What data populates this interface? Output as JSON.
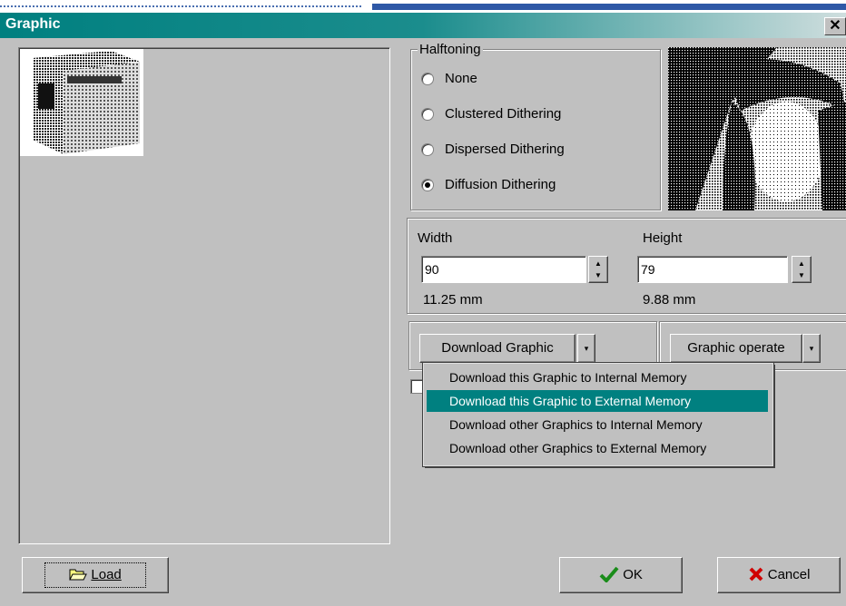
{
  "window": {
    "title": "Graphic",
    "close_glyph": "✕"
  },
  "halftoning": {
    "label": "Halftoning",
    "options": [
      {
        "label": "None",
        "selected": false
      },
      {
        "label": "Clustered Dithering",
        "selected": false
      },
      {
        "label": "Dispersed Dithering",
        "selected": false
      },
      {
        "label": "Diffusion Dithering",
        "selected": true
      }
    ]
  },
  "size": {
    "width_label": "Width",
    "width_value": "90",
    "width_mm": "11.25 mm",
    "height_label": "Height",
    "height_value": "79",
    "height_mm": "9.88 mm"
  },
  "download": {
    "button_label": "Download Graphic",
    "arrow_glyph": "▾",
    "menu_items": [
      {
        "label": "Download this Graphic to Internal Memory",
        "highlighted": false
      },
      {
        "label": "Download this Graphic to External Memory",
        "highlighted": true
      },
      {
        "label": "Download other Graphics to Internal Memory",
        "highlighted": false
      },
      {
        "label": "Download other Graphics to External Memory",
        "highlighted": false
      }
    ]
  },
  "operate": {
    "button_label": "Graphic operate",
    "arrow_glyph": "▾"
  },
  "buttons": {
    "load": {
      "label": "Load",
      "icon": "folder-open-icon"
    },
    "ok": {
      "label": "OK",
      "icon": "checkmark-icon"
    },
    "cancel": {
      "label": "Cancel",
      "icon": "red-x-icon"
    }
  },
  "colors": {
    "title_bar": "#008080",
    "menu_highlight": "#008080",
    "face": "#c0c0c0"
  }
}
